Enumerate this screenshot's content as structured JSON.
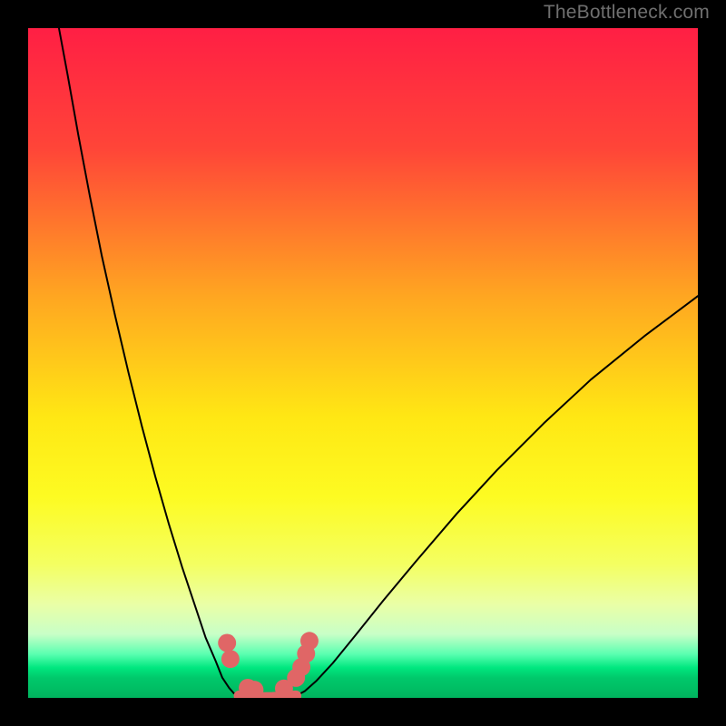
{
  "watermark": "TheBottleneck.com",
  "chart_data": {
    "type": "line",
    "title": "",
    "xlabel": "",
    "ylabel": "",
    "xlim": [
      0,
      100
    ],
    "ylim": [
      0,
      100
    ],
    "gradient_stops": [
      {
        "offset": 0.0,
        "color": "#ff1f44"
      },
      {
        "offset": 0.18,
        "color": "#ff4538"
      },
      {
        "offset": 0.4,
        "color": "#ffa621"
      },
      {
        "offset": 0.58,
        "color": "#ffe714"
      },
      {
        "offset": 0.7,
        "color": "#fdfb22"
      },
      {
        "offset": 0.8,
        "color": "#f4ff61"
      },
      {
        "offset": 0.86,
        "color": "#eaffa6"
      },
      {
        "offset": 0.905,
        "color": "#c8ffc7"
      },
      {
        "offset": 0.935,
        "color": "#59ffb0"
      },
      {
        "offset": 0.955,
        "color": "#00e77f"
      },
      {
        "offset": 0.97,
        "color": "#00c96b"
      },
      {
        "offset": 1.0,
        "color": "#00b45e"
      }
    ],
    "series": [
      {
        "name": "left-branch",
        "stroke": "#000000",
        "x": [
          4.6,
          5.9,
          7.5,
          9.2,
          11.0,
          13.0,
          15.0,
          17.0,
          19.0,
          21.0,
          23.0,
          25.0,
          26.5,
          28.0,
          29.0,
          30.0,
          30.7,
          31.5
        ],
        "y": [
          100.0,
          93.0,
          84.0,
          75.0,
          66.0,
          57.0,
          48.5,
          40.5,
          33.0,
          26.0,
          19.5,
          13.5,
          9.0,
          5.5,
          3.0,
          1.5,
          0.7,
          0.3
        ]
      },
      {
        "name": "right-branch",
        "stroke": "#000000",
        "x": [
          40.0,
          41.3,
          43.0,
          45.5,
          49.0,
          53.0,
          58.0,
          64.0,
          70.0,
          77.0,
          84.0,
          92.0,
          100.0
        ],
        "y": [
          0.3,
          1.0,
          2.5,
          5.2,
          9.5,
          14.5,
          20.5,
          27.5,
          34.0,
          41.0,
          47.5,
          54.0,
          60.0
        ]
      },
      {
        "name": "valley-floor",
        "stroke": "#e06666",
        "x": [
          31.5,
          32.5,
          33.5,
          35.0,
          36.5,
          38.0,
          39.0,
          40.0
        ],
        "y": [
          0.3,
          0.15,
          0.08,
          0.05,
          0.08,
          0.15,
          0.25,
          0.3
        ]
      }
    ],
    "markers": [
      {
        "name": "left-knee-upper",
        "x": 29.7,
        "y": 8.2,
        "r": 1.35,
        "color": "#e06666"
      },
      {
        "name": "left-knee-lower",
        "x": 30.2,
        "y": 5.8,
        "r": 1.35,
        "color": "#e06666"
      },
      {
        "name": "floor-start-a",
        "x": 32.8,
        "y": 1.5,
        "r": 1.35,
        "color": "#e06666"
      },
      {
        "name": "floor-start-b",
        "x": 33.8,
        "y": 1.2,
        "r": 1.35,
        "color": "#e06666"
      },
      {
        "name": "floor-end",
        "x": 38.2,
        "y": 1.4,
        "r": 1.35,
        "color": "#e06666"
      },
      {
        "name": "right-knee-a",
        "x": 40.0,
        "y": 3.0,
        "r": 1.35,
        "color": "#e06666"
      },
      {
        "name": "right-knee-b",
        "x": 40.8,
        "y": 4.6,
        "r": 1.35,
        "color": "#e06666"
      },
      {
        "name": "right-knee-c",
        "x": 41.5,
        "y": 6.6,
        "r": 1.35,
        "color": "#e06666"
      },
      {
        "name": "right-knee-d",
        "x": 42.0,
        "y": 8.5,
        "r": 1.35,
        "color": "#e06666"
      }
    ]
  }
}
